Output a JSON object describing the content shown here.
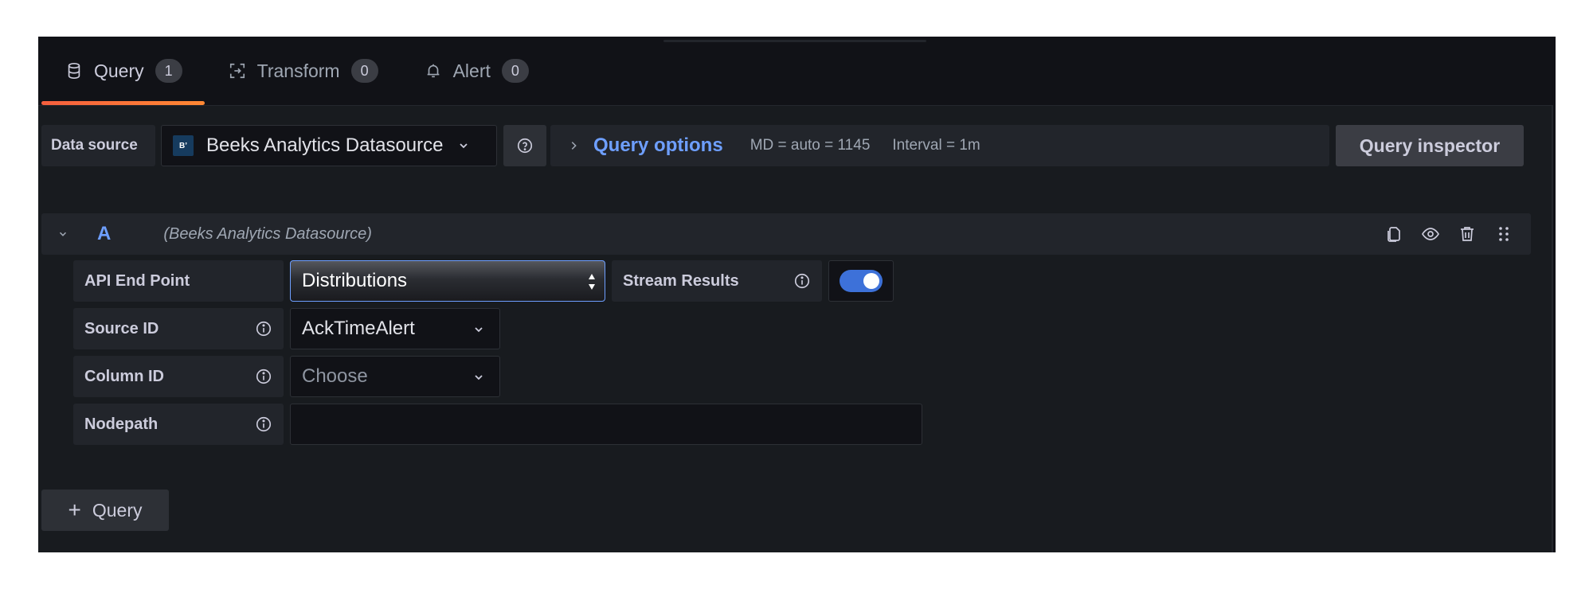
{
  "tabs": [
    {
      "label": "Query",
      "count": "1",
      "icon": "database-icon",
      "active": true
    },
    {
      "label": "Transform",
      "count": "0",
      "icon": "transform-icon",
      "active": false
    },
    {
      "label": "Alert",
      "count": "0",
      "icon": "bell-icon",
      "active": false
    }
  ],
  "toolbar": {
    "datasource_label": "Data source",
    "datasource_logo_text": "B’",
    "datasource_name": "Beeks Analytics Datasource",
    "query_options_label": "Query options",
    "md_info": "MD = auto = 1145",
    "interval_info": "Interval = 1m",
    "query_inspector_label": "Query inspector"
  },
  "query_row": {
    "name": "A",
    "datasource": "(Beeks Analytics Datasource)"
  },
  "form": {
    "api_end_point_label": "API End Point",
    "api_end_point_value": "Distributions",
    "stream_results_label": "Stream Results",
    "stream_results_enabled": true,
    "source_id_label": "Source ID",
    "source_id_value": "AckTimeAlert",
    "column_id_label": "Column ID",
    "column_id_placeholder": "Choose",
    "nodepath_label": "Nodepath",
    "nodepath_value": ""
  },
  "add_query_label": "Query",
  "colors": {
    "accent_blue": "#6e9fff",
    "toggle_on": "#3d71d9",
    "tab_underline": "#f55f3e",
    "background": "#111217"
  }
}
